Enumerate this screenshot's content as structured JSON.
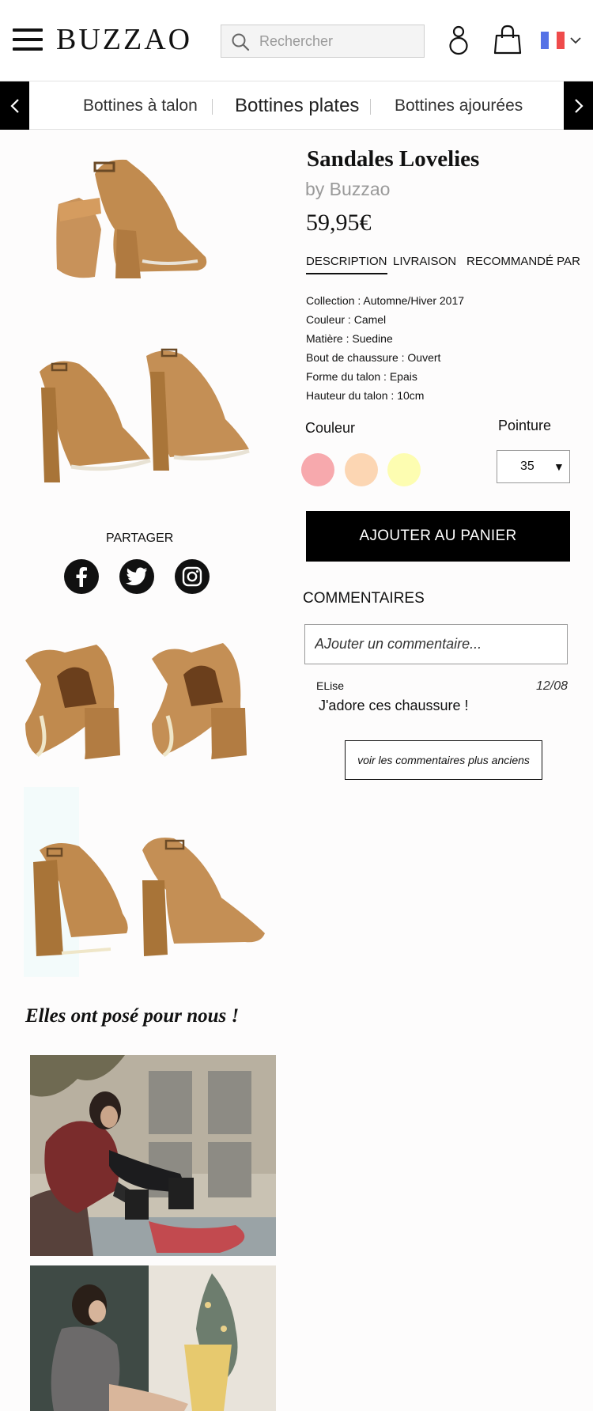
{
  "header": {
    "logo": "BUZZAO",
    "search_placeholder": "Rechercher",
    "flag_colors": [
      "#5572e6",
      "#ffffff",
      "#ef4b4b"
    ]
  },
  "categories": {
    "items": [
      "Bottines à talon",
      "Bottines plates",
      "Bottines ajourées"
    ],
    "active": 1
  },
  "product": {
    "title": "Sandales Lovelies",
    "brand": "by Buzzao",
    "price": "59,95€",
    "tabs": [
      "DESCRIPTION",
      "LIVRAISON",
      "RECOMMANDÉ PAR"
    ],
    "active_tab": 0,
    "specs": [
      {
        "label": "Collection :",
        "value": "Automne/Hiver 2017"
      },
      {
        "label": "Couleur :",
        "value": "Camel"
      },
      {
        "label": "Matière :",
        "value": "Suedine"
      },
      {
        "label": "Bout de chaussure :",
        "value": "Ouvert"
      },
      {
        "label": "Forme du talon :",
        "value": "Epais"
      },
      {
        "label": "Hauteur du talon :",
        "value": "10cm"
      }
    ],
    "color_label": "Couleur",
    "size_label": "Pointure",
    "swatches": [
      "#f7a9ad",
      "#fcd6b3",
      "#fdfdb1"
    ],
    "size_value": "35",
    "cart_button": "AJOUTER AU PANIER"
  },
  "share": {
    "label": "PARTAGER",
    "icons": [
      "facebook-icon",
      "twitter-icon",
      "instagram-icon"
    ]
  },
  "comments": {
    "title": "COMMENTAIRES",
    "placeholder": "AJouter un commentaire...",
    "items": [
      {
        "author": "ELise",
        "date": "12/08",
        "text": "J'adore ces chaussure !"
      }
    ],
    "older_button": "voir les commentaires plus anciens"
  },
  "posed": {
    "title": "Elles ont posé pour nous !"
  },
  "colors": {
    "camel": "#c08a4e",
    "camel_dark": "#9c6a35",
    "black": "#000000"
  }
}
